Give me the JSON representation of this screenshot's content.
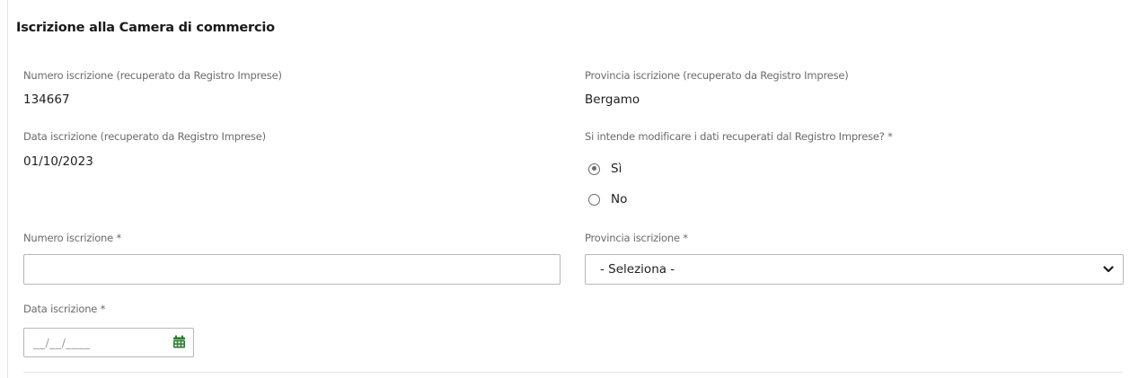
{
  "section": {
    "title": "Iscrizione alla Camera di commercio"
  },
  "registry": {
    "numero_label": "Numero iscrizione (recuperato da Registro Imprese)",
    "numero_value": "134667",
    "provincia_label": "Provincia iscrizione (recuperato da Registro Imprese)",
    "provincia_value": "Bergamo",
    "data_label": "Data iscrizione (recuperato da Registro Imprese)",
    "data_value": "01/10/2023"
  },
  "modify_question": {
    "label": "Si intende modificare i dati recuperati dal Registro Imprese? *",
    "options": [
      {
        "label": "Sì",
        "checked": true
      },
      {
        "label": "No",
        "checked": false
      }
    ]
  },
  "form": {
    "numero_label": "Numero iscrizione *",
    "numero_value": "",
    "provincia_label": "Provincia iscrizione *",
    "provincia_selected": "- Seleziona -",
    "data_label": "Data iscrizione *",
    "data_placeholder": "__/__/____"
  },
  "icons": {
    "select_arrow": "chevron-down-icon",
    "date_picker": "calendar-icon"
  },
  "colors": {
    "calendar_icon": "#2e7d32",
    "label_text": "#6b6b6b",
    "input_border": "#b7b7b7"
  }
}
